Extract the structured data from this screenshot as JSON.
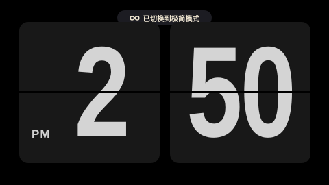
{
  "toast": {
    "icon": "infinity-icon",
    "text": "已切换到极简模式"
  },
  "clock": {
    "hour": "2",
    "minute": "50",
    "period": "PM"
  },
  "colors": {
    "background": "#000000",
    "card": "#181818",
    "digit": "#d4d4d4",
    "toast_bg": "#1c1c22",
    "toast_text": "#f0e7d2"
  }
}
